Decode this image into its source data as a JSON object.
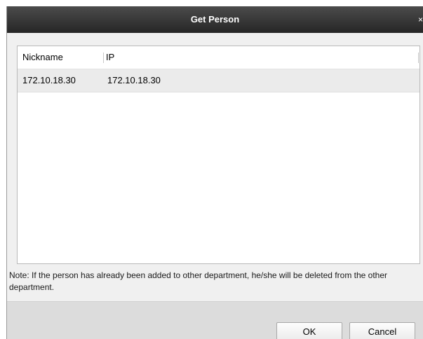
{
  "dialog": {
    "title": "Get Person",
    "close_glyph": "×"
  },
  "table": {
    "columns": [
      "Nickname",
      "IP"
    ],
    "rows": [
      {
        "nickname": "172.10.18.30",
        "ip": "172.10.18.30"
      }
    ]
  },
  "note": "Note: If the person has already been added to other department, he/she will be deleted from the other department.",
  "buttons": {
    "ok_label": "OK",
    "cancel_label": "Cancel"
  },
  "colors": {
    "titlebar": "#333333",
    "selected_row": "#ebebeb",
    "footer": "#dcdcdc"
  }
}
